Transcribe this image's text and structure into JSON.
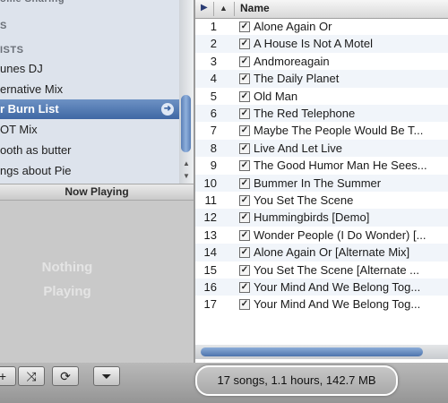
{
  "sidebar": {
    "items": [
      {
        "label": "ome Sharing",
        "type": "header-cut"
      },
      {
        "label": "S",
        "type": "header"
      },
      {
        "label": "ISTS",
        "type": "header"
      },
      {
        "label": "unes DJ",
        "type": "item"
      },
      {
        "label": "ernative Mix",
        "type": "item"
      },
      {
        "label": "r Burn List",
        "type": "selected"
      },
      {
        "label": "OT Mix",
        "type": "item"
      },
      {
        "label": "ooth as butter",
        "type": "item"
      },
      {
        "label": "ngs about Pie",
        "type": "item"
      }
    ],
    "selected_arrow_icon": "arrow-right-circle-icon"
  },
  "now_playing": {
    "header": "Now Playing",
    "line1": "Nothing",
    "line2": "Playing"
  },
  "track_list": {
    "column_name": "Name",
    "tracks": [
      {
        "num": "1",
        "title": "Alone Again Or"
      },
      {
        "num": "2",
        "title": "A House Is Not A Motel"
      },
      {
        "num": "3",
        "title": "Andmoreagain"
      },
      {
        "num": "4",
        "title": "The Daily Planet"
      },
      {
        "num": "5",
        "title": "Old Man"
      },
      {
        "num": "6",
        "title": "The Red Telephone"
      },
      {
        "num": "7",
        "title": "Maybe The People Would Be T..."
      },
      {
        "num": "8",
        "title": "Live And Let Live"
      },
      {
        "num": "9",
        "title": "The Good Humor Man He Sees..."
      },
      {
        "num": "10",
        "title": "Bummer In The Summer"
      },
      {
        "num": "11",
        "title": "You Set The Scene"
      },
      {
        "num": "12",
        "title": "Hummingbirds [Demo]"
      },
      {
        "num": "13",
        "title": "Wonder People (I Do Wonder) [..."
      },
      {
        "num": "14",
        "title": "Alone Again Or [Alternate Mix]"
      },
      {
        "num": "15",
        "title": "You Set The Scene  [Alternate ..."
      },
      {
        "num": "16",
        "title": "Your Mind And We Belong Tog..."
      },
      {
        "num": "17",
        "title": "Your Mind And We Belong Tog..."
      }
    ]
  },
  "status_bar": {
    "summary": "17 songs, 1.1 hours, 142.7 MB"
  },
  "bottom_buttons": {
    "shuffle_icon": "shuffle-icon",
    "repeat_icon": "repeat-icon",
    "show_browser_icon": "eject-down-icon"
  }
}
